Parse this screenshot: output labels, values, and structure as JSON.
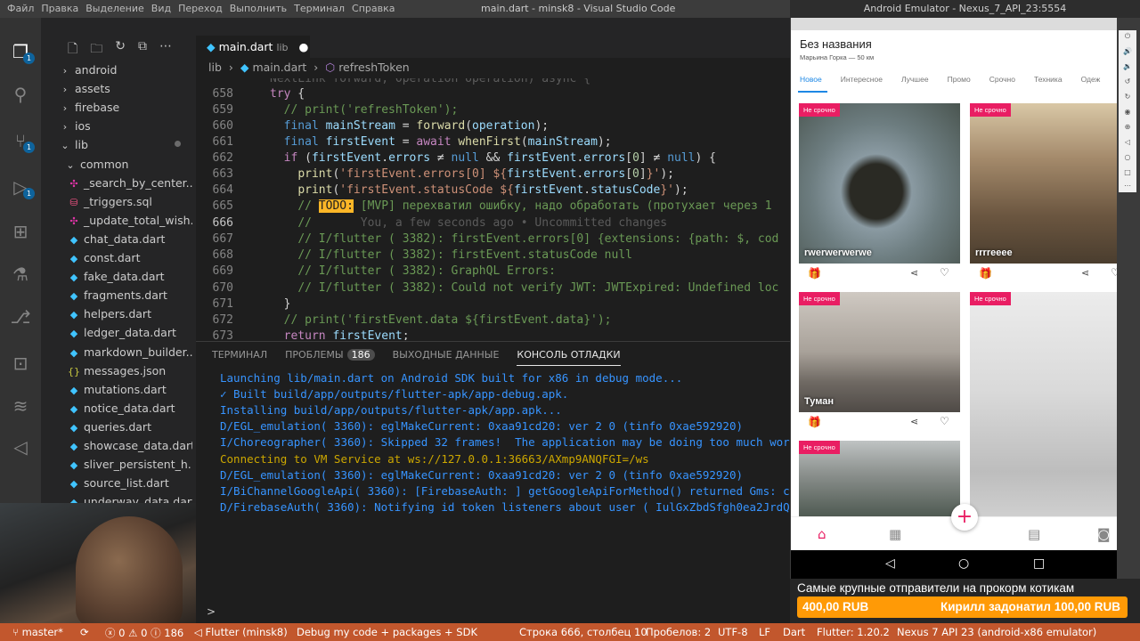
{
  "vscode": {
    "menu": [
      "Файл",
      "Правка",
      "Выделение",
      "Вид",
      "Переход",
      "Выполнить",
      "Терминал",
      "Справка"
    ],
    "window_title": "main.dart - minsk8 - Visual Studio Code",
    "activity_badges": {
      "explorer": "1",
      "scm": "1",
      "debug": "1"
    },
    "explorer": {
      "items": [
        {
          "label": "android",
          "icon": "chevron-right"
        },
        {
          "label": "assets",
          "icon": "chevron-right"
        },
        {
          "label": "firebase",
          "icon": "chevron-right"
        },
        {
          "label": "ios",
          "icon": "chevron-right"
        },
        {
          "label": "lib",
          "icon": "chevron-down"
        },
        {
          "label": "common",
          "icon": "chevron-down"
        },
        {
          "label": "_search_by_center...",
          "icon": "graphql"
        },
        {
          "label": "_triggers.sql",
          "icon": "sql"
        },
        {
          "label": "_update_total_wish...",
          "icon": "graphql"
        },
        {
          "label": "chat_data.dart",
          "icon": "dart"
        },
        {
          "label": "const.dart",
          "icon": "dart"
        },
        {
          "label": "fake_data.dart",
          "icon": "dart"
        },
        {
          "label": "fragments.dart",
          "icon": "dart"
        },
        {
          "label": "helpers.dart",
          "icon": "dart"
        },
        {
          "label": "ledger_data.dart",
          "icon": "dart"
        },
        {
          "label": "markdown_builder....",
          "icon": "dart"
        },
        {
          "label": "messages.json",
          "icon": "json"
        },
        {
          "label": "mutations.dart",
          "icon": "dart"
        },
        {
          "label": "notice_data.dart",
          "icon": "dart"
        },
        {
          "label": "queries.dart",
          "icon": "dart"
        },
        {
          "label": "showcase_data.dart",
          "icon": "dart"
        },
        {
          "label": "sliver_persistent_h...",
          "icon": "dart"
        },
        {
          "label": "source_list.dart",
          "icon": "dart"
        },
        {
          "label": "underway_data.dart",
          "icon": "dart"
        }
      ]
    },
    "tab": {
      "file": "main.dart",
      "dir": "lib"
    },
    "breadcrumb": {
      "part1": "lib",
      "part2": "main.dart",
      "part3": "refreshToken"
    },
    "editor": {
      "line_numbers": [
        "658",
        "659",
        "660",
        "661",
        "662",
        "663",
        "664",
        "665",
        "666",
        "667",
        "668",
        "669",
        "670",
        "671",
        "672",
        "673"
      ],
      "partial_line": "NextLink forward, Operation operation) async {",
      "blame": "You, a few seconds ago • Uncommitted changes"
    },
    "panel": {
      "tabs": [
        "ТЕРМИНАЛ",
        "ПРОБЛЕМЫ",
        "ВЫХОДНЫЕ ДАННЫЕ",
        "КОНСОЛЬ ОТЛАДКИ"
      ],
      "problems_count": "186",
      "console": [
        "Launching lib/main.dart on Android SDK built for x86 in debug mode...",
        "✓ Built build/app/outputs/flutter-apk/app-debug.apk.",
        "Installing build/app/outputs/flutter-apk/app.apk...",
        "D/EGL_emulation( 3360): eglMakeCurrent: 0xaa91cd20: ver 2 0 (tinfo 0xae592920)",
        "I/Choreographer( 3360): Skipped 32 frames!  The application may be doing too much work on its ma",
        "Connecting to VM Service at ws://127.0.0.1:36663/AXmp9ANQFGI=/ws",
        "D/EGL_emulation( 3360): eglMakeCurrent: 0xaa91cd20: ver 2 0 (tinfo 0xae592920)",
        "I/BiChannelGoogleApi( 3360): [FirebaseAuth: ] getGoogleApiForMethod() returned Gms: com.google.",
        "D/FirebaseAuth( 3360): Notifying id token listeners about user ( IulGxZbdSfgh0ea2JrdQFoHjYa42 )."
      ],
      "prompt": ">"
    },
    "statusbar": {
      "branch": "master*",
      "errors": "0",
      "warnings": "0",
      "infos": "186",
      "flutter": "Flutter (minsk8)",
      "debug": "Debug my code + packages + SDK",
      "position": "Строка 666, столбец 10",
      "spaces": "Пробелов: 2",
      "encoding": "UTF-8",
      "eol": "LF",
      "language": "Dart",
      "flutter_version": "Flutter: 1.20.2",
      "device": "Nexus 7 API 23 (android-x86 emulator)"
    }
  },
  "emulator": {
    "title": "Android Emulator - Nexus_7_API_23:5554",
    "app": {
      "title": "Без названия",
      "subtitle": "Марьина Горка — 50 км",
      "tabs": [
        "Новое",
        "Интересное",
        "Лучшее",
        "Промо",
        "Срочно",
        "Техника",
        "Одеж"
      ],
      "badge": "Не срочно",
      "cards": [
        {
          "title": "rwerwerwerwe"
        },
        {
          "title": "rrrreeee"
        },
        {
          "title": "Туман"
        },
        {
          "title": ""
        },
        {
          "title": ""
        }
      ]
    }
  },
  "donation": {
    "headline": "Самые крупные отправители на прокорм котикам",
    "amount": "400,00 RUB",
    "latest": "Кирилл задонатил 100,00 RUB"
  }
}
